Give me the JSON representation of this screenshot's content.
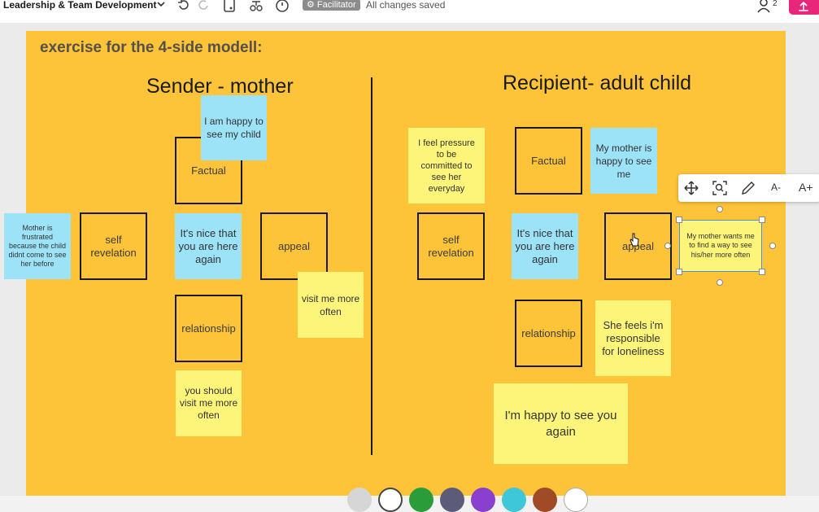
{
  "toolbar": {
    "board_title": "Leadership & Team Development",
    "facilitator_badge": "Facilitator",
    "status": "All changes saved",
    "user_count": "2"
  },
  "frame": {
    "title": "exercise for the 4-side modell:"
  },
  "sender": {
    "heading": "Sender - mother",
    "boxes": {
      "factual": "Factual",
      "self_revelation": "self revelation",
      "appeal": "appeal",
      "relationship": "relationship"
    },
    "notes": {
      "top": "I am happy to see my child",
      "center": "It's nice that you are here again",
      "left": "Mother is frustrated because the child didnt come to see her before",
      "right": "visit me more often",
      "bottom": "you should visit me more often"
    }
  },
  "recipient": {
    "heading": "Recipient- adult child",
    "boxes": {
      "factual": "Factual",
      "self_revelation": "self revelation",
      "appeal": "appeal",
      "relationship": "relationship"
    },
    "notes": {
      "pressure": "I feel pressure to be committed to see her everyday",
      "happy": "My mother is happy to see me",
      "center": "It's nice that you are here again",
      "selected": "My mother wants me to find a way to see his/her more often",
      "lonely": "She feels i'm responsible for loneliness",
      "bottom": "I'm happy to see you again"
    }
  },
  "context_toolbar": {
    "icons": [
      "move-icon",
      "zoom-to-fit-icon",
      "pen-icon",
      "decrease-font-icon",
      "increase-font-icon"
    ],
    "decrease_label": "A-",
    "increase_label": "A+"
  },
  "colors": {
    "frame": "#fdc339",
    "blue_note": "#9ce3f8",
    "yellow_note": "#fdf57a",
    "share_button": "#e8267a",
    "badge": "#8c8c8c"
  }
}
